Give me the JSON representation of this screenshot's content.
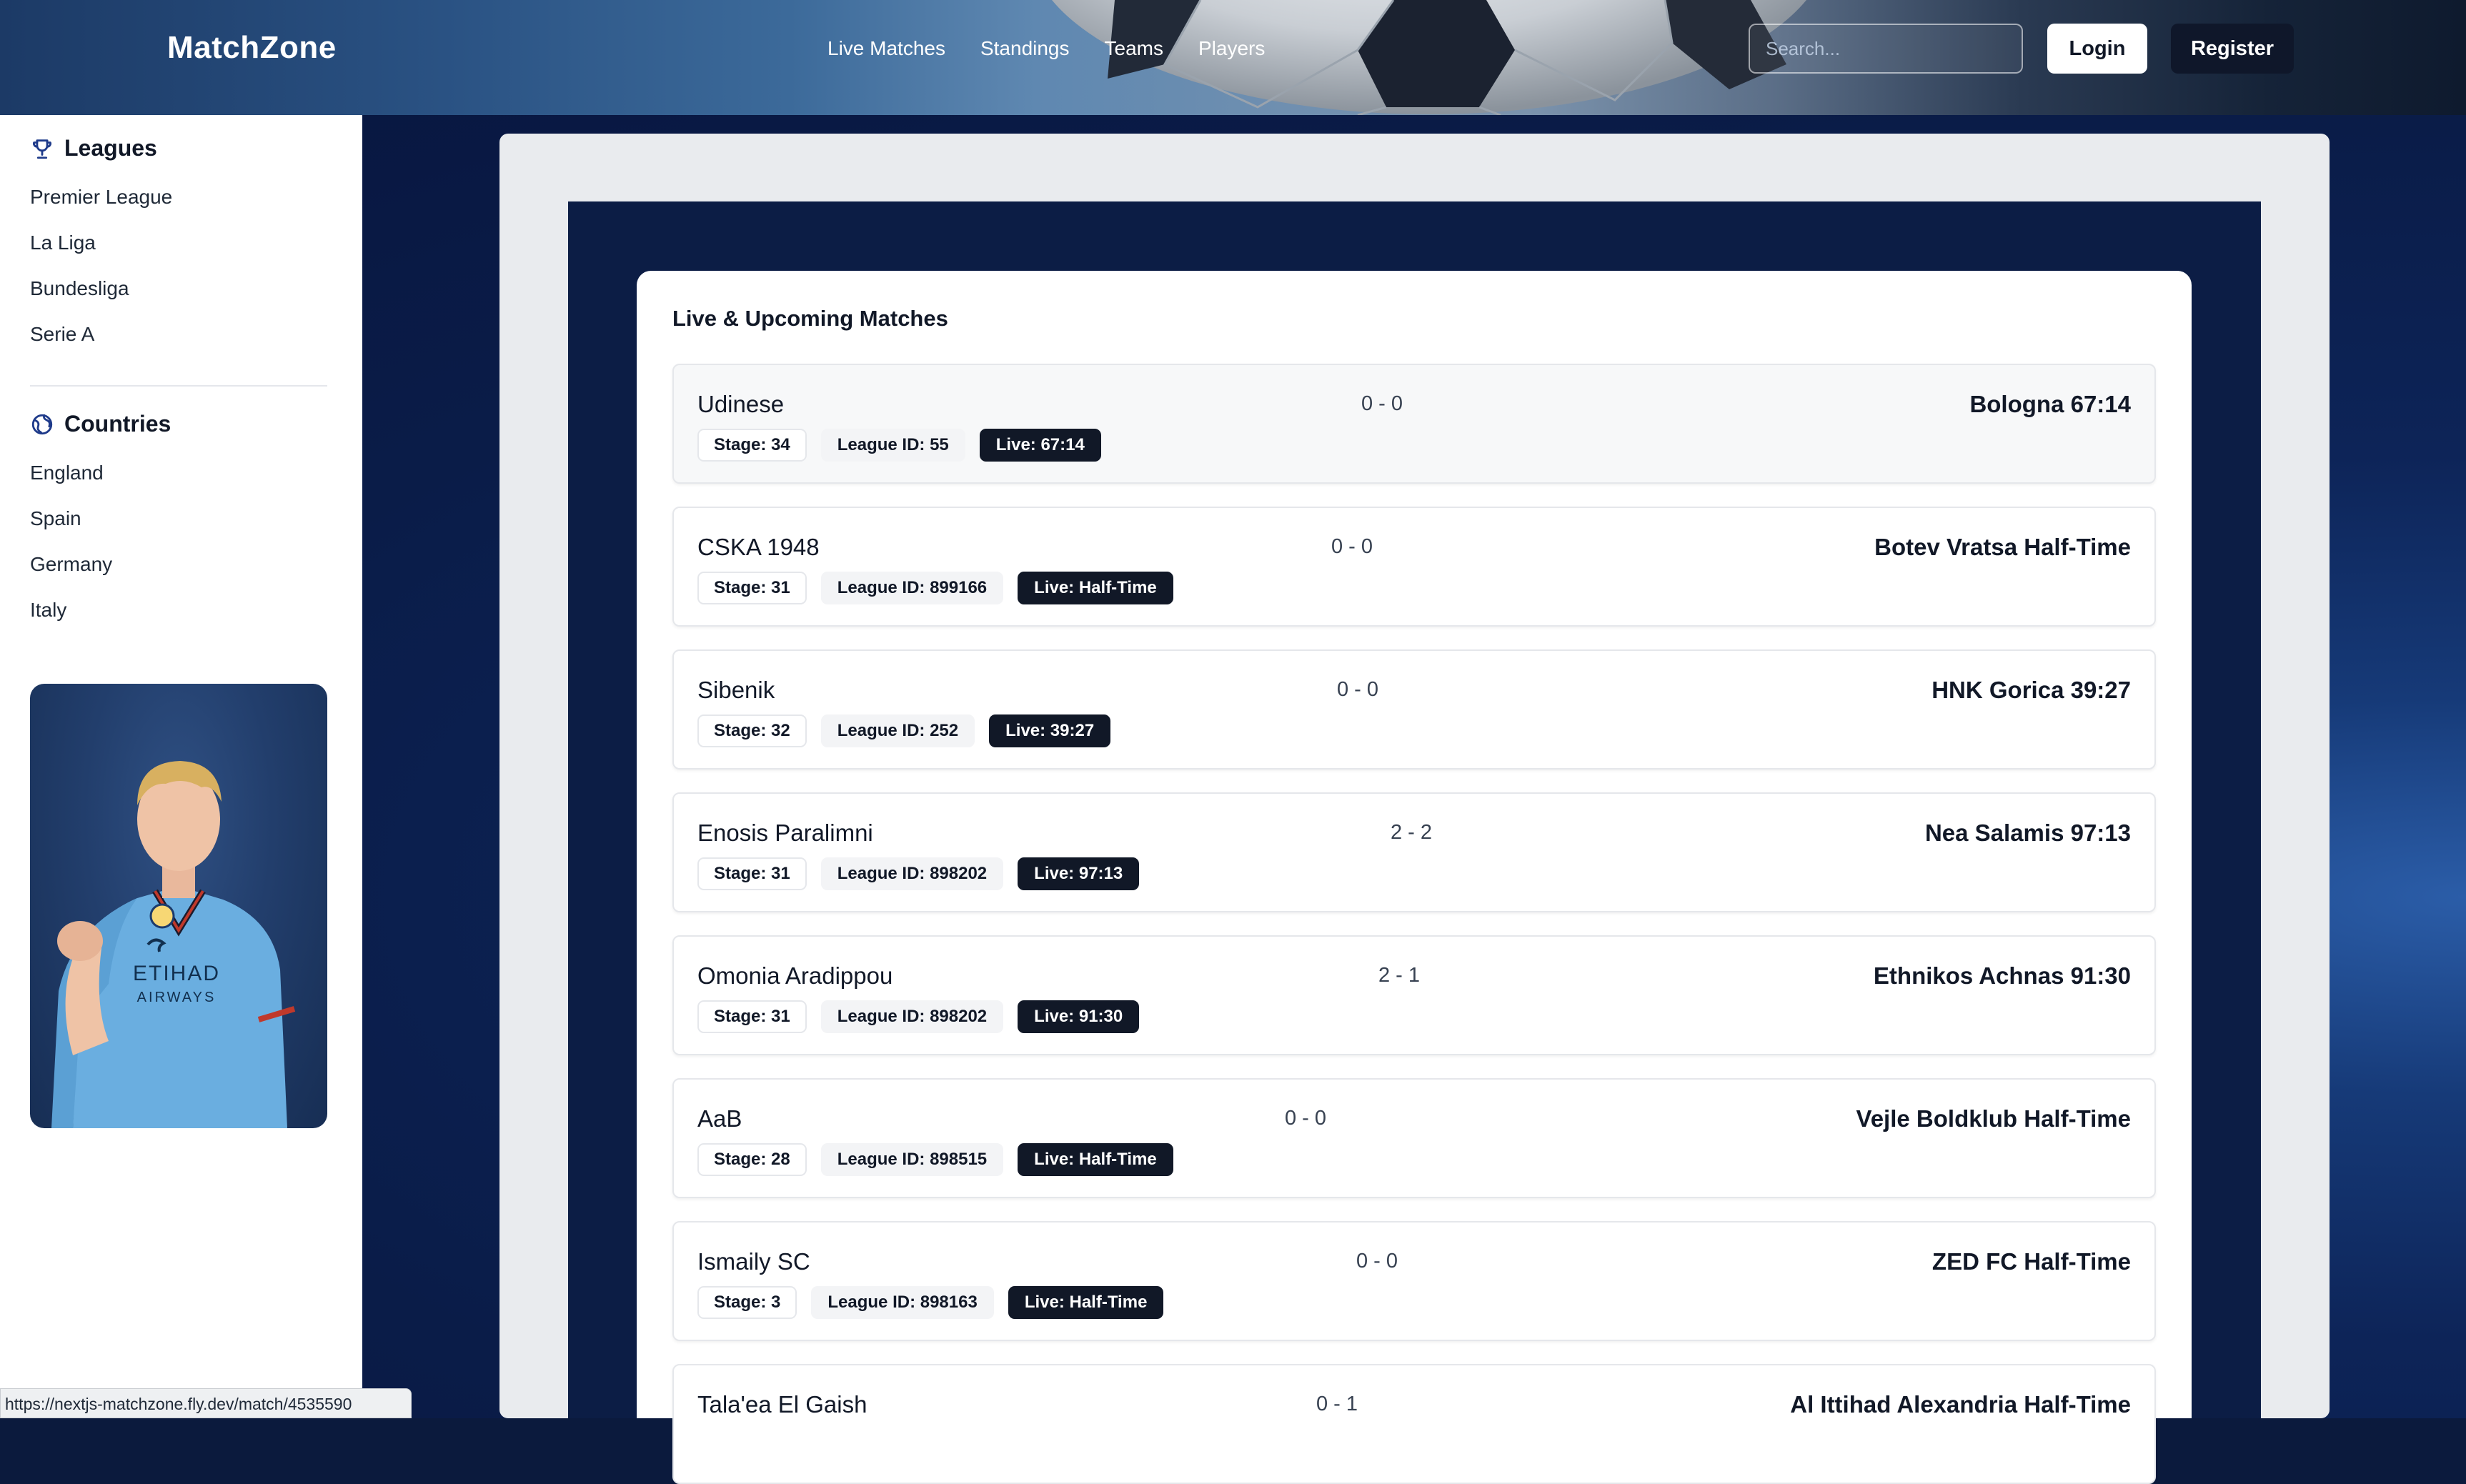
{
  "header": {
    "logo": "MatchZone",
    "nav": [
      "Live Matches",
      "Standings",
      "Teams",
      "Players"
    ],
    "search_placeholder": "Search...",
    "login_label": "Login",
    "register_label": "Register"
  },
  "sidebar": {
    "leagues_heading": "Leagues",
    "leagues": [
      "Premier League",
      "La Liga",
      "Bundesliga",
      "Serie A"
    ],
    "countries_heading": "Countries",
    "countries": [
      "England",
      "Spain",
      "Germany",
      "Italy"
    ],
    "player_card_alt": "ETIHAD AIRWAYS"
  },
  "main": {
    "title": "Live & Upcoming Matches",
    "matches": [
      {
        "home": "Udinese",
        "score": "0 - 0",
        "away": "Bologna 67:14",
        "stage": "Stage: 34",
        "league": "League ID: 55",
        "live": "Live: 67:14"
      },
      {
        "home": "CSKA 1948",
        "score": "0 - 0",
        "away": "Botev Vratsa Half-Time",
        "stage": "Stage: 31",
        "league": "League ID: 899166",
        "live": "Live: Half-Time"
      },
      {
        "home": "Sibenik",
        "score": "0 - 0",
        "away": "HNK Gorica 39:27",
        "stage": "Stage: 32",
        "league": "League ID: 252",
        "live": "Live: 39:27"
      },
      {
        "home": "Enosis Paralimni",
        "score": "2 - 2",
        "away": "Nea Salamis 97:13",
        "stage": "Stage: 31",
        "league": "League ID: 898202",
        "live": "Live: 97:13"
      },
      {
        "home": "Omonia Aradippou",
        "score": "2 - 1",
        "away": "Ethnikos Achnas 91:30",
        "stage": "Stage: 31",
        "league": "League ID: 898202",
        "live": "Live: 91:30"
      },
      {
        "home": "AaB",
        "score": "0 - 0",
        "away": "Vejle Boldklub Half-Time",
        "stage": "Stage: 28",
        "league": "League ID: 898515",
        "live": "Live: Half-Time"
      },
      {
        "home": "Ismaily SC",
        "score": "0 - 0",
        "away": "ZED FC Half-Time",
        "stage": "Stage: 3",
        "league": "League ID: 898163",
        "live": "Live: Half-Time"
      },
      {
        "home": "Tala'ea El Gaish",
        "score": "0 - 1",
        "away": "Al Ittihad Alexandria Half-Time",
        "stage": "",
        "league": "",
        "live": ""
      }
    ]
  },
  "statusbar": {
    "url": "https://nextjs-matchzone.fly.dev/match/4535590"
  },
  "colors": {
    "header_dark": "#0f172a",
    "live_badge": "#111827",
    "page_bg": "#0b1a3d",
    "panel_bg": "#e9ebee"
  },
  "icons": {
    "leagues": "trophy-icon",
    "countries": "globe-icon"
  }
}
